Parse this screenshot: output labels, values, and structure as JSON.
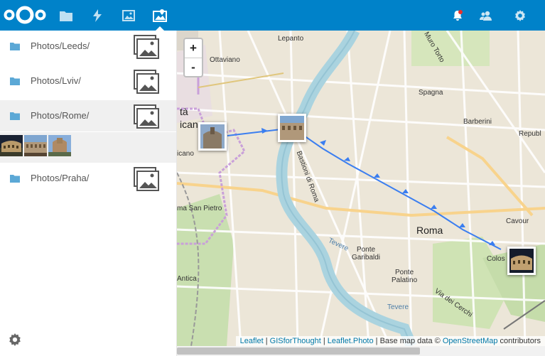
{
  "header": {
    "nav": [
      {
        "icon": "folder-icon",
        "name": "files"
      },
      {
        "icon": "activity-icon",
        "name": "activity"
      },
      {
        "icon": "gallery-icon",
        "name": "gallery"
      },
      {
        "icon": "map-photos-icon",
        "name": "photo-map",
        "active": true
      }
    ],
    "right": [
      "notification-bell-icon",
      "contacts-icon",
      "settings-icon"
    ]
  },
  "sidebar": {
    "albums": [
      {
        "label": "Photos/Leeds/"
      },
      {
        "label": "Photos/Lviv/"
      },
      {
        "label": "Photos/Rome/",
        "selected": true
      },
      {
        "label": "Photos/Praha/"
      }
    ]
  },
  "map": {
    "zoom_in": "+",
    "zoom_out": "-",
    "labels": {
      "lepanto": "Lepanto",
      "ottaviano": "Ottaviano",
      "spagna": "Spagna",
      "barberini": "Barberini",
      "repubblica": "Republ",
      "citta": "tà",
      "vaticano_1": "icano",
      "vaticano_2": "icano",
      "san_pietro": "ma San Pietro",
      "roma": "Roma",
      "cavour": "Cavour",
      "colosseo": "Colos",
      "ponte_garibaldi": "Ponte\nGaribaldi",
      "ponte_palatino": "Ponte\nPalatino",
      "tevere_1": "Tevere",
      "tevere_2": "Tevere",
      "via_cerchi": "Via dei Cerchi",
      "antica": "Antica",
      "muro_torto": "Muro Torto",
      "bastioni": "Bastioni di Roma"
    },
    "attribution": {
      "leaflet": "Leaflet",
      "sep1": " | ",
      "gisforthought": "GISforThought",
      "sep2": " | ",
      "leaflet_photo": "Leaflet.Photo",
      "base": " | Base map data © ",
      "osm": "OpenStreetMap",
      "contributors": " contributors"
    }
  }
}
